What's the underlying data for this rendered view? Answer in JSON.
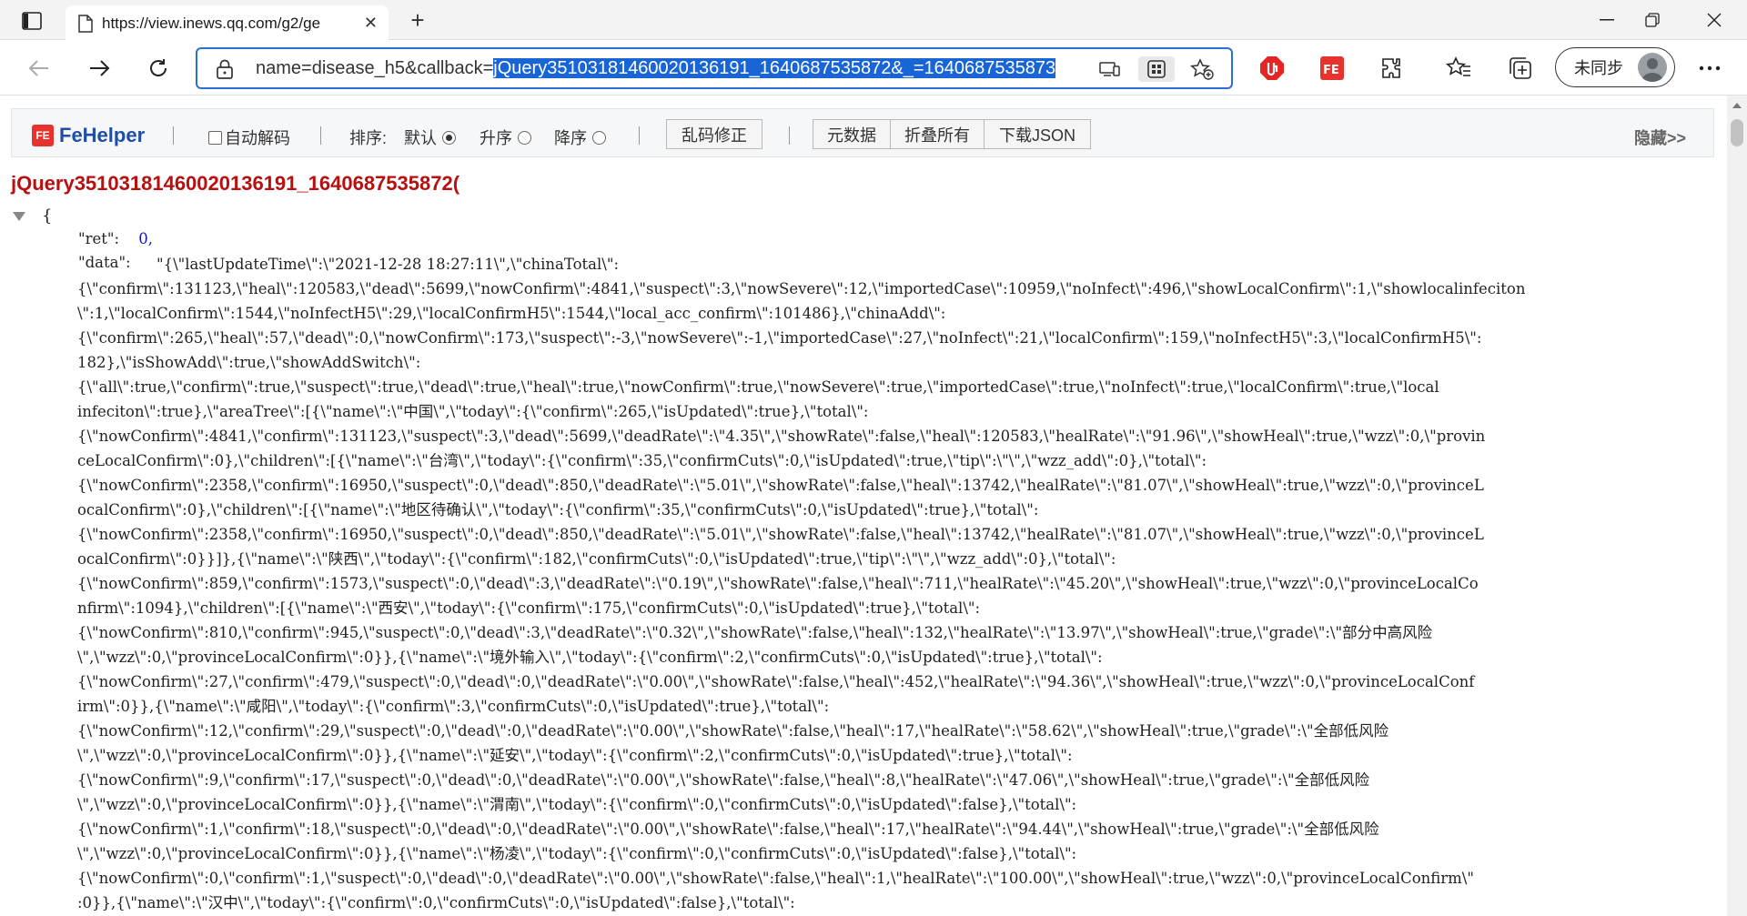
{
  "browser": {
    "tab_title": "https://view.inews.qq.com/g2/ge",
    "address_prefix": "name=disease_h5&callback=",
    "address_selected": "jQuery35103181460020136191_1640687535872&_=1640687535873",
    "profile_label": "未同步",
    "icons": [
      "tab-panel-icon",
      "page-icon",
      "close-icon",
      "plus-icon",
      "minimize-icon",
      "restore-icon",
      "close-window-icon",
      "back-icon",
      "forward-icon",
      "refresh-icon",
      "lock-icon",
      "read-aloud-icon",
      "app-icon",
      "favorite-add-icon",
      "adblock-icon",
      "fehelper-icon",
      "extensions-icon",
      "favorites-icon",
      "collections-icon",
      "more-icon"
    ]
  },
  "fehelper": {
    "logo_text": "FeHelper",
    "logo_badge": "FE",
    "auto_decode_label": "自动解码",
    "sort_label": "排序:",
    "sort_default": "默认",
    "sort_asc": "升序",
    "sort_desc": "降序",
    "fix_encoding_button": "乱码修正",
    "raw_data_button": "元数据",
    "collapse_all_button": "折叠所有",
    "download_json_button": "下载JSON",
    "hide_label": "隐藏>>"
  },
  "json_view": {
    "callback_name": "jQuery35103181460020136191_1640687535872(",
    "open_brace": "{",
    "ret_key": "\"ret\":",
    "ret_value": "0,",
    "data_key": "\"data\":",
    "data_lines": [
      "\"{\\\"lastUpdateTime\\\":\\\"2021-12-28 18:27:11\\\",\\\"chinaTotal\\\":",
      "{\\\"confirm\\\":131123,\\\"heal\\\":120583,\\\"dead\\\":5699,\\\"nowConfirm\\\":4841,\\\"suspect\\\":3,\\\"nowSevere\\\":12,\\\"importedCase\\\":10959,\\\"noInfect\\\":496,\\\"showLocalConfirm\\\":1,\\\"showlocalinfeciton",
      "\\\":1,\\\"localConfirm\\\":1544,\\\"noInfectH5\\\":29,\\\"localConfirmH5\\\":1544,\\\"local_acc_confirm\\\":101486},\\\"chinaAdd\\\":",
      "{\\\"confirm\\\":265,\\\"heal\\\":57,\\\"dead\\\":0,\\\"nowConfirm\\\":173,\\\"suspect\\\":-3,\\\"nowSevere\\\":-1,\\\"importedCase\\\":27,\\\"noInfect\\\":21,\\\"localConfirm\\\":159,\\\"noInfectH5\\\":3,\\\"localConfirmH5\\\":",
      "182},\\\"isShowAdd\\\":true,\\\"showAddSwitch\\\":",
      "{\\\"all\\\":true,\\\"confirm\\\":true,\\\"suspect\\\":true,\\\"dead\\\":true,\\\"heal\\\":true,\\\"nowConfirm\\\":true,\\\"nowSevere\\\":true,\\\"importedCase\\\":true,\\\"noInfect\\\":true,\\\"localConfirm\\\":true,\\\"local",
      "infeciton\\\":true},\\\"areaTree\\\":[{\\\"name\\\":\\\"中国\\\",\\\"today\\\":{\\\"confirm\\\":265,\\\"isUpdated\\\":true},\\\"total\\\":",
      "{\\\"nowConfirm\\\":4841,\\\"confirm\\\":131123,\\\"suspect\\\":3,\\\"dead\\\":5699,\\\"deadRate\\\":\\\"4.35\\\",\\\"showRate\\\":false,\\\"heal\\\":120583,\\\"healRate\\\":\\\"91.96\\\",\\\"showHeal\\\":true,\\\"wzz\\\":0,\\\"provin",
      "ceLocalConfirm\\\":0},\\\"children\\\":[{\\\"name\\\":\\\"台湾\\\",\\\"today\\\":{\\\"confirm\\\":35,\\\"confirmCuts\\\":0,\\\"isUpdated\\\":true,\\\"tip\\\":\\\"\\\",\\\"wzz_add\\\":0},\\\"total\\\":",
      "{\\\"nowConfirm\\\":2358,\\\"confirm\\\":16950,\\\"suspect\\\":0,\\\"dead\\\":850,\\\"deadRate\\\":\\\"5.01\\\",\\\"showRate\\\":false,\\\"heal\\\":13742,\\\"healRate\\\":\\\"81.07\\\",\\\"showHeal\\\":true,\\\"wzz\\\":0,\\\"provinceL",
      "ocalConfirm\\\":0},\\\"children\\\":[{\\\"name\\\":\\\"地区待确认\\\",\\\"today\\\":{\\\"confirm\\\":35,\\\"confirmCuts\\\":0,\\\"isUpdated\\\":true},\\\"total\\\":",
      "{\\\"nowConfirm\\\":2358,\\\"confirm\\\":16950,\\\"suspect\\\":0,\\\"dead\\\":850,\\\"deadRate\\\":\\\"5.01\\\",\\\"showRate\\\":false,\\\"heal\\\":13742,\\\"healRate\\\":\\\"81.07\\\",\\\"showHeal\\\":true,\\\"wzz\\\":0,\\\"provinceL",
      "ocalConfirm\\\":0}}]},{\\\"name\\\":\\\"陕西\\\",\\\"today\\\":{\\\"confirm\\\":182,\\\"confirmCuts\\\":0,\\\"isUpdated\\\":true,\\\"tip\\\":\\\"\\\",\\\"wzz_add\\\":0},\\\"total\\\":",
      "{\\\"nowConfirm\\\":859,\\\"confirm\\\":1573,\\\"suspect\\\":0,\\\"dead\\\":3,\\\"deadRate\\\":\\\"0.19\\\",\\\"showRate\\\":false,\\\"heal\\\":711,\\\"healRate\\\":\\\"45.20\\\",\\\"showHeal\\\":true,\\\"wzz\\\":0,\\\"provinceLocalCo",
      "nfirm\\\":1094},\\\"children\\\":[{\\\"name\\\":\\\"西安\\\",\\\"today\\\":{\\\"confirm\\\":175,\\\"confirmCuts\\\":0,\\\"isUpdated\\\":true},\\\"total\\\":",
      "{\\\"nowConfirm\\\":810,\\\"confirm\\\":945,\\\"suspect\\\":0,\\\"dead\\\":3,\\\"deadRate\\\":\\\"0.32\\\",\\\"showRate\\\":false,\\\"heal\\\":132,\\\"healRate\\\":\\\"13.97\\\",\\\"showHeal\\\":true,\\\"grade\\\":\\\"部分中高风险",
      "\\\",\\\"wzz\\\":0,\\\"provinceLocalConfirm\\\":0}},{\\\"name\\\":\\\"境外输入\\\",\\\"today\\\":{\\\"confirm\\\":2,\\\"confirmCuts\\\":0,\\\"isUpdated\\\":true},\\\"total\\\":",
      "{\\\"nowConfirm\\\":27,\\\"confirm\\\":479,\\\"suspect\\\":0,\\\"dead\\\":0,\\\"deadRate\\\":\\\"0.00\\\",\\\"showRate\\\":false,\\\"heal\\\":452,\\\"healRate\\\":\\\"94.36\\\",\\\"showHeal\\\":true,\\\"wzz\\\":0,\\\"provinceLocalConf",
      "irm\\\":0}},{\\\"name\\\":\\\"咸阳\\\",\\\"today\\\":{\\\"confirm\\\":3,\\\"confirmCuts\\\":0,\\\"isUpdated\\\":true},\\\"total\\\":",
      "{\\\"nowConfirm\\\":12,\\\"confirm\\\":29,\\\"suspect\\\":0,\\\"dead\\\":0,\\\"deadRate\\\":\\\"0.00\\\",\\\"showRate\\\":false,\\\"heal\\\":17,\\\"healRate\\\":\\\"58.62\\\",\\\"showHeal\\\":true,\\\"grade\\\":\\\"全部低风险",
      "\\\",\\\"wzz\\\":0,\\\"provinceLocalConfirm\\\":0}},{\\\"name\\\":\\\"延安\\\",\\\"today\\\":{\\\"confirm\\\":2,\\\"confirmCuts\\\":0,\\\"isUpdated\\\":true},\\\"total\\\":",
      "{\\\"nowConfirm\\\":9,\\\"confirm\\\":17,\\\"suspect\\\":0,\\\"dead\\\":0,\\\"deadRate\\\":\\\"0.00\\\",\\\"showRate\\\":false,\\\"heal\\\":8,\\\"healRate\\\":\\\"47.06\\\",\\\"showHeal\\\":true,\\\"grade\\\":\\\"全部低风险",
      "\\\",\\\"wzz\\\":0,\\\"provinceLocalConfirm\\\":0}},{\\\"name\\\":\\\"渭南\\\",\\\"today\\\":{\\\"confirm\\\":0,\\\"confirmCuts\\\":0,\\\"isUpdated\\\":false},\\\"total\\\":",
      "{\\\"nowConfirm\\\":1,\\\"confirm\\\":18,\\\"suspect\\\":0,\\\"dead\\\":0,\\\"deadRate\\\":\\\"0.00\\\",\\\"showRate\\\":false,\\\"heal\\\":17,\\\"healRate\\\":\\\"94.44\\\",\\\"showHeal\\\":true,\\\"grade\\\":\\\"全部低风险",
      "\\\",\\\"wzz\\\":0,\\\"provinceLocalConfirm\\\":0}},{\\\"name\\\":\\\"杨凌\\\",\\\"today\\\":{\\\"confirm\\\":0,\\\"confirmCuts\\\":0,\\\"isUpdated\\\":false},\\\"total\\\":",
      "{\\\"nowConfirm\\\":0,\\\"confirm\\\":1,\\\"suspect\\\":0,\\\"dead\\\":0,\\\"deadRate\\\":\\\"0.00\\\",\\\"showRate\\\":false,\\\"heal\\\":1,\\\"healRate\\\":\\\"100.00\\\",\\\"showHeal\\\":true,\\\"wzz\\\":0,\\\"provinceLocalConfirm\\\"",
      ":0}},{\\\"name\\\":\\\"汉中\\\",\\\"today\\\":{\\\"confirm\\\":0,\\\"confirmCuts\\\":0,\\\"isUpdated\\\":false},\\\"total\\\":"
    ]
  }
}
